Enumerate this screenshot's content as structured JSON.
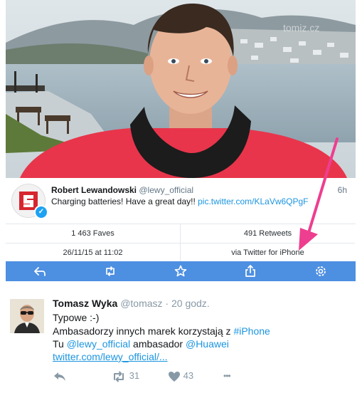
{
  "embedded_tweet": {
    "author_name": "Robert Lewandowski",
    "author_handle": "@lewy_official",
    "time": "6h",
    "text": "Charging batteries! Have a great day!!",
    "link": "pic.twitter.com/KLaVw6QPgF",
    "watermark": "tomiz.cz",
    "verified_badge": "✓",
    "faves": "1 463 Faves",
    "retweets": "491 Retweets",
    "date": "26/11/15 at 11:02",
    "source": "via Twitter for iPhone",
    "toolbar_icons": [
      "reply-icon",
      "retweet-icon",
      "star-icon",
      "share-icon",
      "settings-icon"
    ],
    "colors": {
      "toolbar": "#4d8fe1",
      "link": "#1b95e0",
      "arrow": "#ee3e8f",
      "sweater": "#e8354b"
    }
  },
  "reply_tweet": {
    "author_name": "Tomasz Wyka",
    "author_handle": "@tomasz",
    "separator": "·",
    "time": "20 godz.",
    "line1": "Typowe :-)",
    "line2_text": "Ambasadorzy innych marek korzystają z ",
    "line2_hashtag": "#iPhone",
    "line3_prefix": "Tu ",
    "line3_mention1": "@lewy_official",
    "line3_mid": " ambasador ",
    "line3_mention2": "@Huawei",
    "line4_link": "twitter.com/lewy_official/...",
    "retweet_count": "31",
    "like_count": "43",
    "more": "•••",
    "colors": {
      "link": "#1b95e0",
      "muted": "#8899a6"
    }
  }
}
